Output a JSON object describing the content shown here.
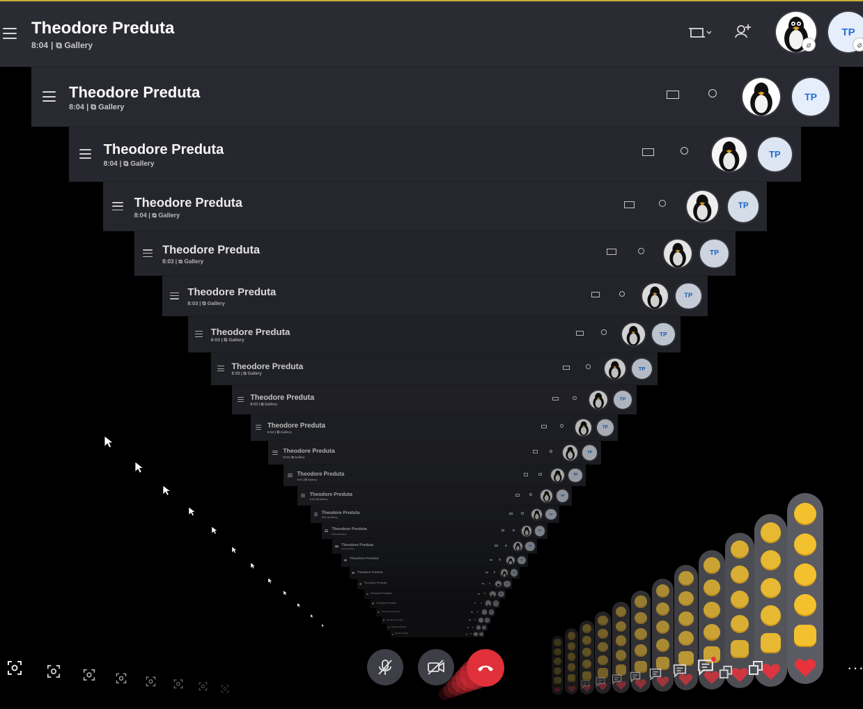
{
  "call": {
    "title": "Theodore Preduta",
    "duration": "8:04",
    "duration_alt": "8:03",
    "view_mode": "Gallery",
    "separator": "|"
  },
  "participants": [
    {
      "name": "tux-avatar",
      "initials": ""
    },
    {
      "name": "tp-avatar",
      "initials": "TP"
    }
  ],
  "controls": {
    "more_label": "···"
  },
  "colors": {
    "header_bg": "#2b2c33",
    "accent_top": "#c9b037",
    "end_call": "#e0303a",
    "tp_text": "#1f6fd6"
  }
}
